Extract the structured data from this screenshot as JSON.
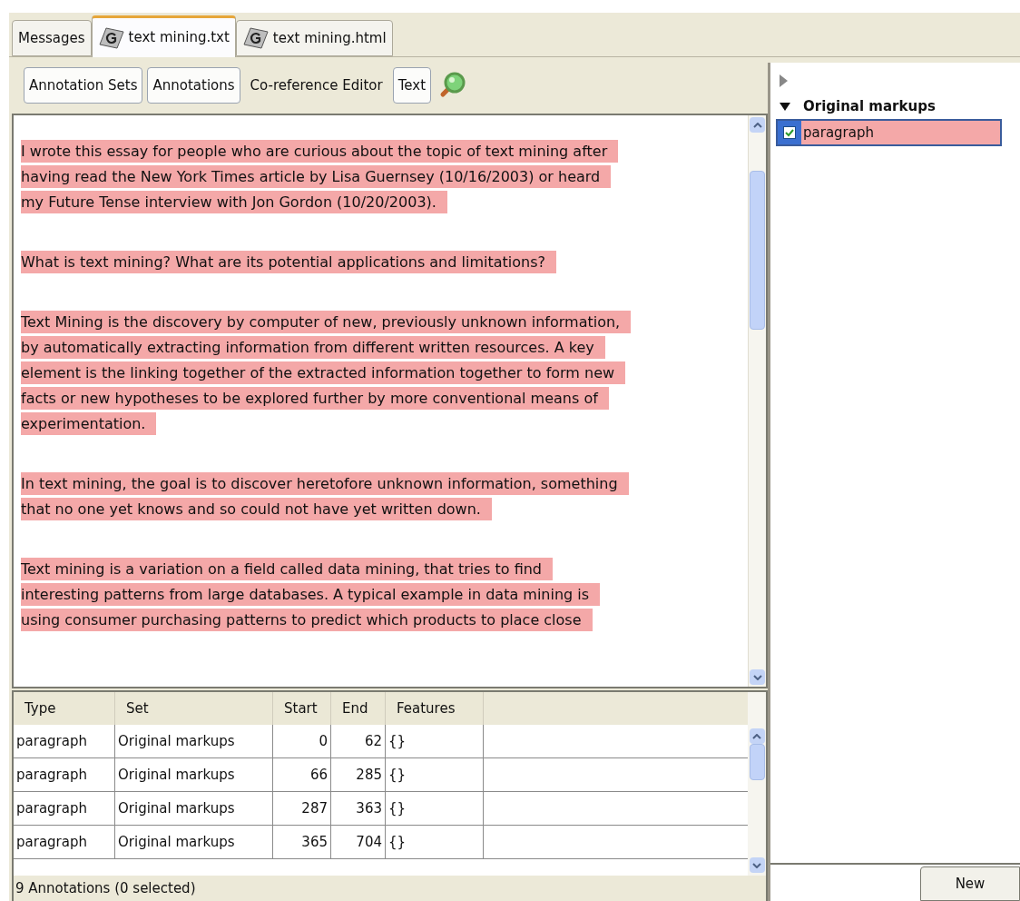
{
  "tabs": [
    {
      "label": "Messages",
      "kind": "plain",
      "selected": false
    },
    {
      "label": "text mining.txt",
      "kind": "document",
      "selected": true
    },
    {
      "label": "text mining.html",
      "kind": "document",
      "selected": false
    }
  ],
  "toolbar": [
    {
      "label": "Annotation Sets",
      "selected": true
    },
    {
      "label": "Annotations",
      "selected": true
    },
    {
      "label": "Co-reference Editor",
      "selected": false
    },
    {
      "label": "Text",
      "selected": true
    }
  ],
  "document": {
    "paragraphs": [
      [
        "I wrote this essay for people who are curious about the topic of text mining after",
        "having read the New York Times article by Lisa Guernsey (10/16/2003) or heard",
        "my Future Tense interview with Jon Gordon (10/20/2003)."
      ],
      [
        "What is text mining? What are its potential applications and limitations?"
      ],
      [
        "Text Mining is the discovery by computer of new, previously unknown information,",
        "by automatically extracting information from different written resources. A key",
        "element is the linking together of the extracted information together to form new",
        "facts or new hypotheses to be explored further by more conventional means of",
        "experimentation."
      ],
      [
        "In text mining, the goal is to discover heretofore unknown information, something",
        "that no one yet knows and so could not have yet written down."
      ],
      [
        "Text mining is a variation on a field called data mining, that tries to find",
        "interesting patterns from large databases. A typical example in data mining is",
        "using consumer purchasing patterns to predict which products to place close"
      ]
    ]
  },
  "table": {
    "columns": [
      "Type",
      "Set",
      "Start",
      "End",
      "Features"
    ],
    "rows": [
      [
        "paragraph",
        "Original markups",
        "0",
        "62",
        "{}"
      ],
      [
        "paragraph",
        "Original markups",
        "66",
        "285",
        "{}"
      ],
      [
        "paragraph",
        "Original markups",
        "287",
        "363",
        "{}"
      ],
      [
        "paragraph",
        "Original markups",
        "365",
        "704",
        "{}"
      ]
    ]
  },
  "status_bar": "9 Annotations (0 selected)",
  "annotation_sets": [
    {
      "expanded": false
    },
    {
      "name": "Original markups",
      "expanded": true,
      "types": [
        {
          "name": "paragraph",
          "checked": true,
          "selected": true,
          "color": "#f4a8a8"
        }
      ]
    }
  ],
  "new_button": "New"
}
